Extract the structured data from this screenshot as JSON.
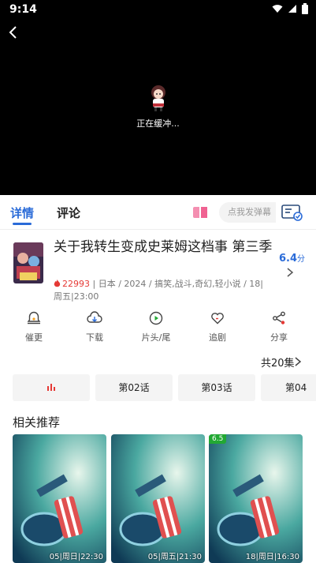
{
  "status_bar": {
    "time": "9:14"
  },
  "player": {
    "buffering_text": "正在缓冲..."
  },
  "tabs": {
    "detail": "详情",
    "comment": "评论"
  },
  "danmu": {
    "placeholder": "点我发弹幕"
  },
  "show": {
    "title": "关于我转生变成史莱姆这档事 第三季",
    "rating_value": "6.4",
    "rating_unit": "分",
    "heat": "22993",
    "meta": "| 日本 / 2024 / 搞笑,战斗,奇幻,轻小说 / 18|周五|23:00"
  },
  "actions": [
    {
      "label": "催更",
      "icon": "bell-icon"
    },
    {
      "label": "下载",
      "icon": "cloud-download-icon"
    },
    {
      "label": "片头/尾",
      "icon": "play-circle-icon"
    },
    {
      "label": "追剧",
      "icon": "heart-icon"
    },
    {
      "label": "分享",
      "icon": "share-icon"
    }
  ],
  "episodes": {
    "total": "共20集",
    "items": [
      {
        "label": "",
        "playing": true
      },
      {
        "label": "第02话"
      },
      {
        "label": "第03话"
      },
      {
        "label": "第04"
      }
    ]
  },
  "recommendations": {
    "title": "相关推荐",
    "items": [
      {
        "label": "05|周日|22:30",
        "score": ""
      },
      {
        "label": "05|周五|21:30",
        "score": ""
      },
      {
        "label": "18|周日|16:30",
        "score": "6.5"
      }
    ]
  },
  "colors": {
    "accent": "#2a6bd8",
    "heat": "#e53935",
    "score_badge": "#22a833"
  }
}
